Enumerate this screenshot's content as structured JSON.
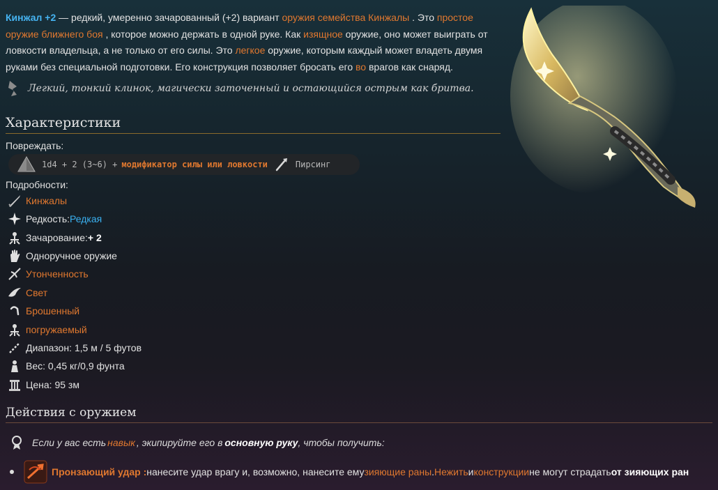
{
  "intro": {
    "title": "Кинжал +2",
    "t1": " — редкий, умеренно зачарованный (+2) вариант ",
    "link_family": "оружия семейства Кинжалы",
    "t2": " . Это ",
    "link_simple": "простое оружие ближнего боя",
    "t3": " , которое можно держать в одной руке. Как ",
    "link_finesse": "изящное",
    "t4": " оружие, оно может выиграть от ловкости владельца, а не только от его силы. Это ",
    "link_light": "легкое",
    "t5": " оружие, которым каждый может владеть двумя руками без специальной подготовки. Его конструкция позволяет бросать его ",
    "link_at": "во",
    "t6": " врагов как снаряд."
  },
  "quote": "Легкий, тонкий клинок, магически заточенный и остающийся острым как бритва.",
  "stats": {
    "title": "Характеристики",
    "damage_label": "Повреждать:",
    "damage_dice": "1d4 + 2 (3~6) +",
    "damage_mod": "модификатор силы или ловкости",
    "damage_type": "Пирсинг",
    "details_label": "Подробности:"
  },
  "details": [
    {
      "icon": "dagger-icon",
      "pre": "",
      "val": "Кинжалы",
      "style": "link"
    },
    {
      "icon": "rarity-icon",
      "pre": "Редкость: ",
      "val": "Редкая",
      "style": "blue"
    },
    {
      "icon": "enchant-icon",
      "pre": "Зачарование: ",
      "val": "+ 2",
      "style": "bold"
    },
    {
      "icon": "one-handed-icon",
      "pre": "Одноручное оружие",
      "val": "",
      "style": ""
    },
    {
      "icon": "finesse-icon",
      "pre": "",
      "val": "Утонченность",
      "style": "link"
    },
    {
      "icon": "light-icon",
      "pre": "",
      "val": "Свет",
      "style": "link"
    },
    {
      "icon": "thrown-icon",
      "pre": "",
      "val": "Брошенный",
      "style": "link"
    },
    {
      "icon": "dippable-icon",
      "pre": "",
      "val": "погружаемый",
      "style": "link"
    },
    {
      "icon": "range-icon",
      "pre": "Диапазон: 1,5 м / 5 футов",
      "val": "",
      "style": ""
    },
    {
      "icon": "weight-icon",
      "pre": "Вес: 0,45 кг/0,9 фунта",
      "val": "",
      "style": ""
    },
    {
      "icon": "price-icon",
      "pre": "Цена: 95 зм",
      "val": "",
      "style": ""
    }
  ],
  "actions": {
    "title": "Действия с оружием",
    "p1": "Если у вас есть ",
    "p_link": "навык",
    "p2": " , экипируйте его в ",
    "p_bold": "основную руку",
    "p3": " , чтобы получить:",
    "name": "Пронзающий удар :",
    "a1": " нанесите удар врагу и, возможно, нанесите ему ",
    "a_link1": "зияющие раны",
    "a2": " . ",
    "a_link2": "Нежить",
    "a3": " и ",
    "a_link3": "конструкции",
    "a4": " не могут страдать ",
    "a_bold": "от зияющих ран"
  }
}
